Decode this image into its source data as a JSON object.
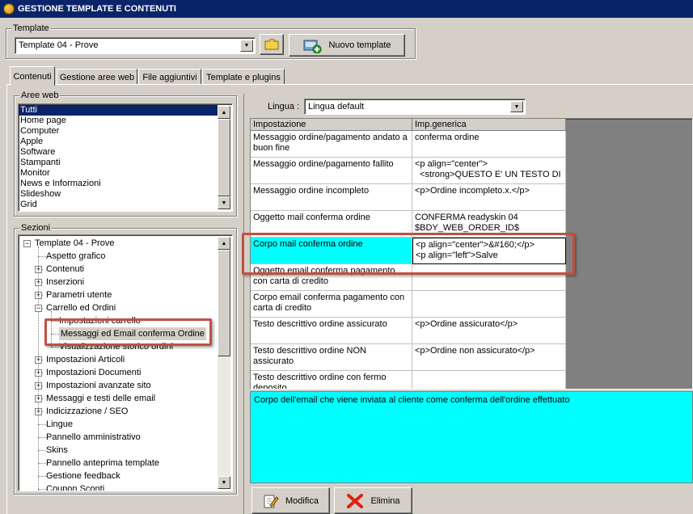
{
  "window": {
    "title": "GESTIONE TEMPLATE E CONTENUTI"
  },
  "template_group": {
    "label": "Template",
    "selected": "Template 04 - Prove",
    "new_button": "Nuovo template"
  },
  "tabs": [
    {
      "label": "Contenuti"
    },
    {
      "label": "Gestione aree web"
    },
    {
      "label": "File aggiuntivi"
    },
    {
      "label": "Template e plugins"
    }
  ],
  "aree_web": {
    "label": "Aree web",
    "items": [
      "Tutti",
      "Home page",
      "Computer",
      "Apple",
      "Software",
      "Stampanti",
      "Monitor",
      "News e Informazioni",
      "Slideshow",
      "Grid"
    ]
  },
  "sezioni": {
    "label": "Sezioni",
    "root": "Template 04 - Prove",
    "items": [
      "Aspetto grafico",
      "Contenuti",
      "Inserzioni",
      "Parametri utente",
      "Carrello ed Ordini",
      "Impostazioni carrello",
      "Messaggi ed Email conferma Ordine",
      "Visualizzazione storico ordini",
      "Impostazioni Articoli",
      "Impostazioni Documenti",
      "Impostazioni avanzate sito",
      "Messaggi e testi delle email",
      "Indicizzazione / SEO",
      "Lingue",
      "Pannello amministrativo",
      "Skins",
      "Pannello anteprima template",
      "Gestione feedback",
      "Coupon Sconti"
    ]
  },
  "lingua": {
    "label": "Lingua :",
    "selected": "Lingua default"
  },
  "grid": {
    "headers": [
      "Impostazione",
      "Imp.generica"
    ],
    "rows": [
      {
        "setting": "Messaggio ordine/pagamento andato a buon fine",
        "value": "conferma ordine"
      },
      {
        "setting": "Messaggio ordine/pagamento fallito",
        "value": "<p align=\"center\">\n  <strong>QUESTO E' UN TESTO DI"
      },
      {
        "setting": "Messaggio ordine incompleto",
        "value": "<p>Ordine incompleto.x.</p>"
      },
      {
        "setting": "Oggetto mail conferma ordine",
        "value": "CONFERMA readyskin 04\n$BDY_WEB_ORDER_ID$"
      },
      {
        "setting": "Corpo mail conferma ordine",
        "value": "<p align=\"center\">&#160;</p>\n<p align=\"left\">Salve"
      },
      {
        "setting": "Oggetto email conferma pagamento con carta di credito",
        "value": ""
      },
      {
        "setting": "Corpo email conferma pagamento con carta di credito",
        "value": ""
      },
      {
        "setting": "Testo descrittivo ordine assicurato",
        "value": "<p>Ordine assicurato</p>"
      },
      {
        "setting": "Testo descrittivo ordine NON assicurato",
        "value": "<p>Ordine non assicurato</p>"
      },
      {
        "setting": "Testo descrittivo ordine con fermo deposito",
        "value": ""
      }
    ]
  },
  "description": "Corpo dell'email che viene inviata al cliente come conferma dell'ordine effettuato",
  "actions": {
    "edit": "Modifica",
    "delete": "Elimina"
  },
  "colors": {
    "highlight": "#00ffff",
    "selection": "#0a246a",
    "callout": "#c05040"
  }
}
